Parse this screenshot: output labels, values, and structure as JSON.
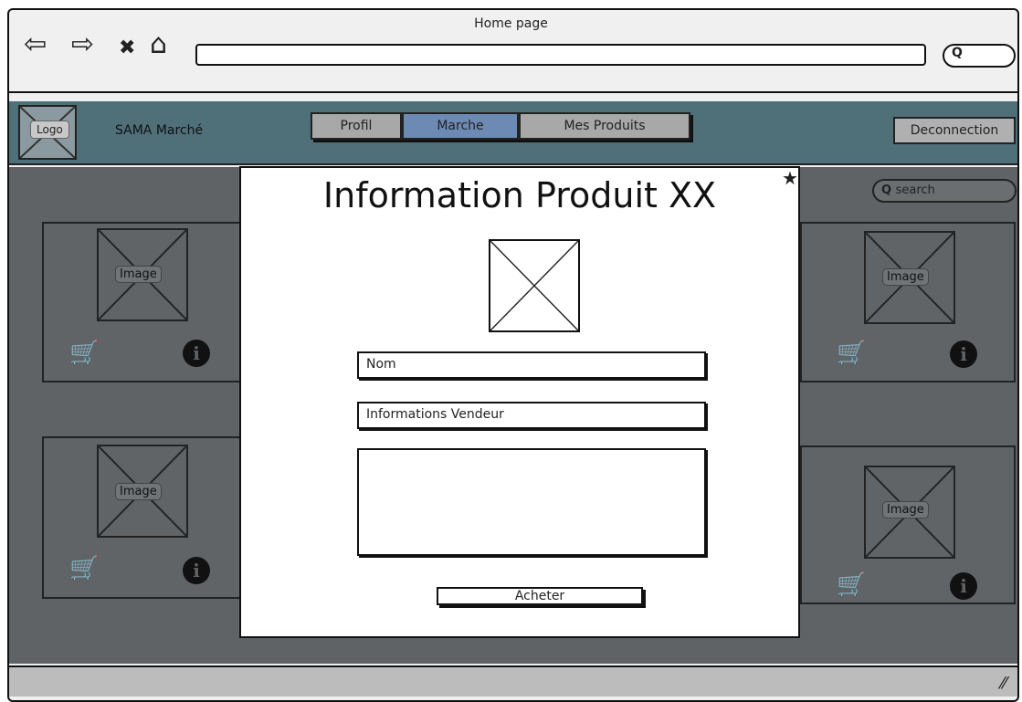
{
  "window": {
    "title": "Home page"
  },
  "browser_nav": {
    "back": "⇦",
    "forward": "⇨",
    "stop": "✖",
    "home": "⌂",
    "search_glyph": "Q"
  },
  "header": {
    "logo_label": "Logo",
    "brand": "SAMA Marché",
    "tabs": [
      {
        "label": "Profil"
      },
      {
        "label": "Marche"
      },
      {
        "label": "Mes Produits"
      }
    ],
    "logout_label": "Deconnection"
  },
  "search": {
    "placeholder": "search"
  },
  "products": [
    {
      "image_label": "Image"
    },
    {
      "image_label": "Image"
    },
    {
      "image_label": "Image"
    },
    {
      "image_label": "Image"
    }
  ],
  "modal": {
    "title": "Information Produit XX",
    "nom_field": "Nom",
    "vendeur_field": "Informations Vendeur",
    "description": "",
    "buy_label": "Acheter"
  },
  "icons": {
    "cart": "add-to-cart-icon",
    "info": "info-icon",
    "close": "star-close-icon"
  }
}
